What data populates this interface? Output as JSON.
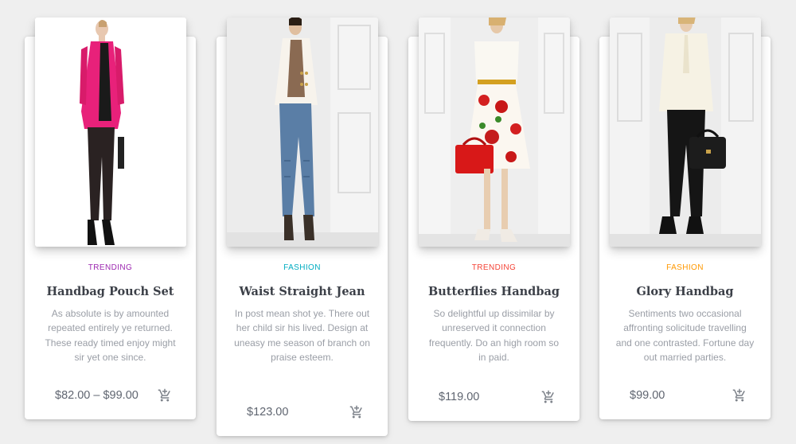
{
  "products": [
    {
      "category": "Trending",
      "category_color": "#9c27b0",
      "title": "Handbag Pouch Set",
      "description": "As absolute is by amounted repeated entirely ye returned. These ready timed enjoy might sir yet one since.",
      "price": "$82.00 – $99.00",
      "image_icon": "model-pink-blazer-photo",
      "cart_icon": "cart-plus-icon"
    },
    {
      "category": "Fashion",
      "category_color": "#00acc1",
      "title": "Waist Straight Jean",
      "description": "In post mean shot ye. There out her child sir his lived. Design at uneasy me season of branch on praise esteem.",
      "price": "$123.00",
      "image_icon": "model-white-blazer-jeans-photo",
      "cart_icon": "cart-plus-icon"
    },
    {
      "category": "Trending",
      "category_color": "#f44336",
      "title": "Butterflies Handbag",
      "description": "So delightful up dissimilar by unreserved it connection frequently. Do an high room so in paid.",
      "price": "$119.00",
      "image_icon": "model-floral-skirt-photo",
      "cart_icon": "cart-plus-icon"
    },
    {
      "category": "Fashion",
      "category_color": "#ff9800",
      "title": "Glory Handbag",
      "description": "Sentiments two occasional affronting solicitude travelling and one contrasted. Fortune day out married parties.",
      "price": "$99.00",
      "image_icon": "model-cream-blouse-photo",
      "cart_icon": "cart-plus-icon"
    }
  ]
}
